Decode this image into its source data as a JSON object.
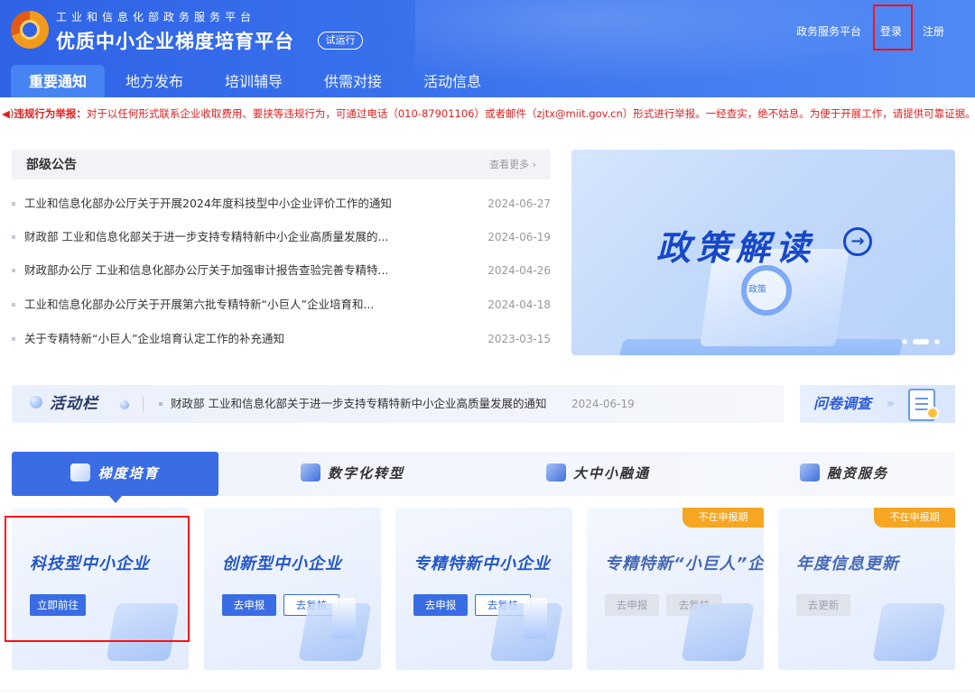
{
  "header": {
    "subtitle": "工业和信息化部政务服务平台",
    "title": "优质中小企业梯度培育平台",
    "trial_badge": "试运行",
    "links": {
      "gov_platform": "政务服务平台",
      "login": "登录",
      "register": "注册"
    }
  },
  "nav": {
    "items": [
      {
        "label": "重要通知",
        "active": true
      },
      {
        "label": "地方发布",
        "active": false
      },
      {
        "label": "培训辅导",
        "active": false
      },
      {
        "label": "供需对接",
        "active": false
      },
      {
        "label": "活动信息",
        "active": false
      }
    ]
  },
  "notice": {
    "label": "违规行为举报：",
    "text": "对于以任何形式联系企业收取费用、要挟等违规行为，可通过电话（010-87901106）或者邮件（zjtx@miit.gov.cn）形式进行举报。一经查实，绝不姑息。为便于开展工作，请提供可靠证据。"
  },
  "announcements": {
    "title": "部级公告",
    "more": "查看更多 ›",
    "items": [
      {
        "title": "工业和信息化部办公厅关于开展2024年度科技型中小企业评价工作的通知",
        "date": "2024-06-27"
      },
      {
        "title": "财政部 工业和信息化部关于进一步支持专精特新中小企业高质量发展的...",
        "date": "2024-06-19"
      },
      {
        "title": "财政部办公厅 工业和信息化部办公厅关于加强审计报告查验完善专精特...",
        "date": "2024-04-26"
      },
      {
        "title": "工业和信息化部办公厅关于开展第六批专精特新“小巨人”企业培育和...",
        "date": "2024-04-18"
      },
      {
        "title": "关于专精特新“小巨人”企业培育认定工作的补充通知",
        "date": "2023-03-15"
      }
    ]
  },
  "banner": {
    "title": "政策解读",
    "arrow": "→",
    "lens_label": "政策"
  },
  "activity": {
    "title": "活动栏",
    "text": "财政部 工业和信息化部关于进一步支持专精特新中小企业高质量发展的通知",
    "date": "2024-06-19"
  },
  "survey": {
    "title": "问卷调查",
    "chev": "»"
  },
  "tabs": [
    {
      "label": "梯度培育",
      "icon": "shield-icon"
    },
    {
      "label": "数字化转型",
      "icon": "chart-icon"
    },
    {
      "label": "大中小融通",
      "icon": "link-icon"
    },
    {
      "label": "融资服务",
      "icon": "finance-icon"
    }
  ],
  "cards": [
    {
      "title": "科技型中小企业",
      "btn1": "立即前往",
      "btn2": ""
    },
    {
      "title": "创新型中小企业",
      "btn1": "去申报",
      "btn2": "去复核"
    },
    {
      "title": "专精特新中小企业",
      "btn1": "去申报",
      "btn2": "去复核"
    },
    {
      "title": "专精特新“小巨人”企业",
      "btn1": "去申报",
      "btn2": "去复核",
      "badge": "不在申报期"
    },
    {
      "title": "年度信息更新",
      "btn1": "去更新",
      "btn2": "",
      "badge": "不在申报期"
    }
  ],
  "colors": {
    "primary": "#3a6de3",
    "header": "#2f63e6",
    "alert": "#e02020",
    "badge": "#f6a623",
    "highlight": "#ff1010"
  }
}
